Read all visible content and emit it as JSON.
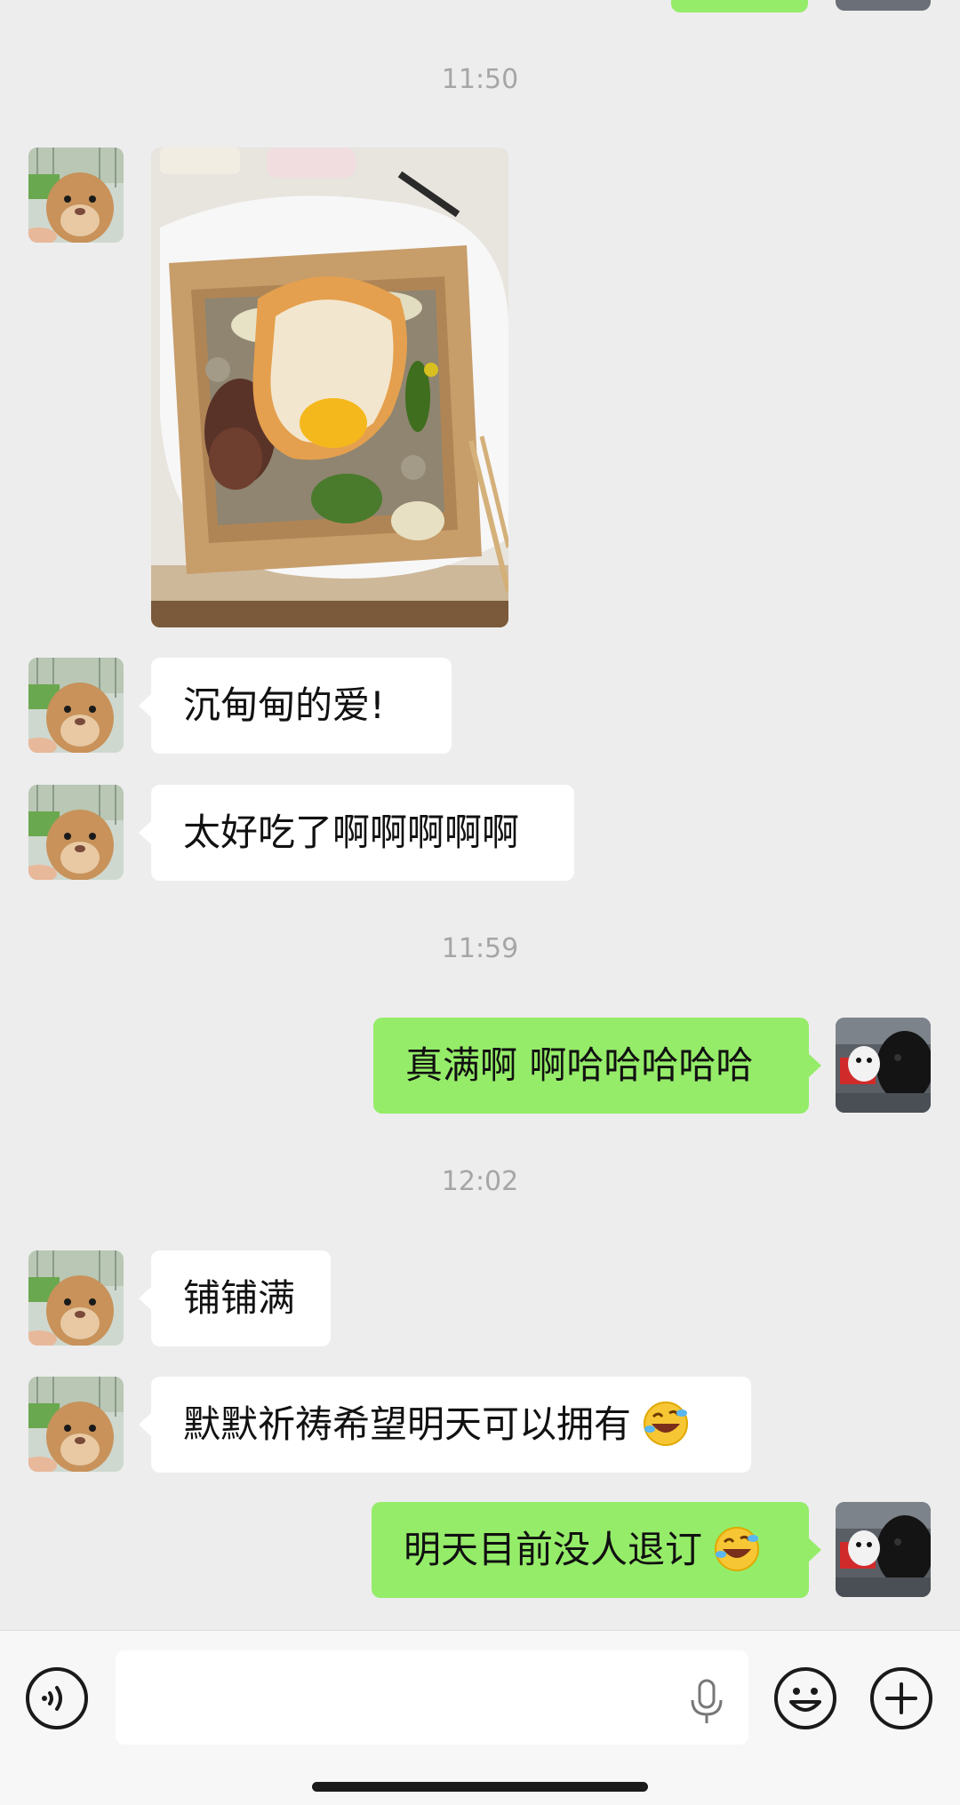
{
  "timestamps": [
    "11:50",
    "11:59",
    "12:02"
  ],
  "messages": [
    {
      "side": "left",
      "text": "沉甸甸的爱!"
    },
    {
      "side": "left",
      "text": "太好吃了啊啊啊啊啊"
    },
    {
      "side": "right",
      "text": "真满啊 啊哈哈哈哈哈"
    },
    {
      "side": "left",
      "text": "铺铺满"
    },
    {
      "side": "left",
      "text": "默默祈祷希望明天可以拥有",
      "emoji": "rofl-emoji"
    },
    {
      "side": "right",
      "text": "明天目前没人退订",
      "emoji": "loudly-crying-laughing-emoji"
    }
  ],
  "input": {
    "placeholder": "",
    "voice_icon": "voice-icon",
    "mic_icon": "mic-icon",
    "emoji_icon": "emoji-face-icon",
    "plus_icon": "plus-icon"
  },
  "colors": {
    "background": "#ededed",
    "sent_bubble": "#95ec69",
    "received_bubble": "#ffffff",
    "timestamp": "#a6a6a6"
  }
}
